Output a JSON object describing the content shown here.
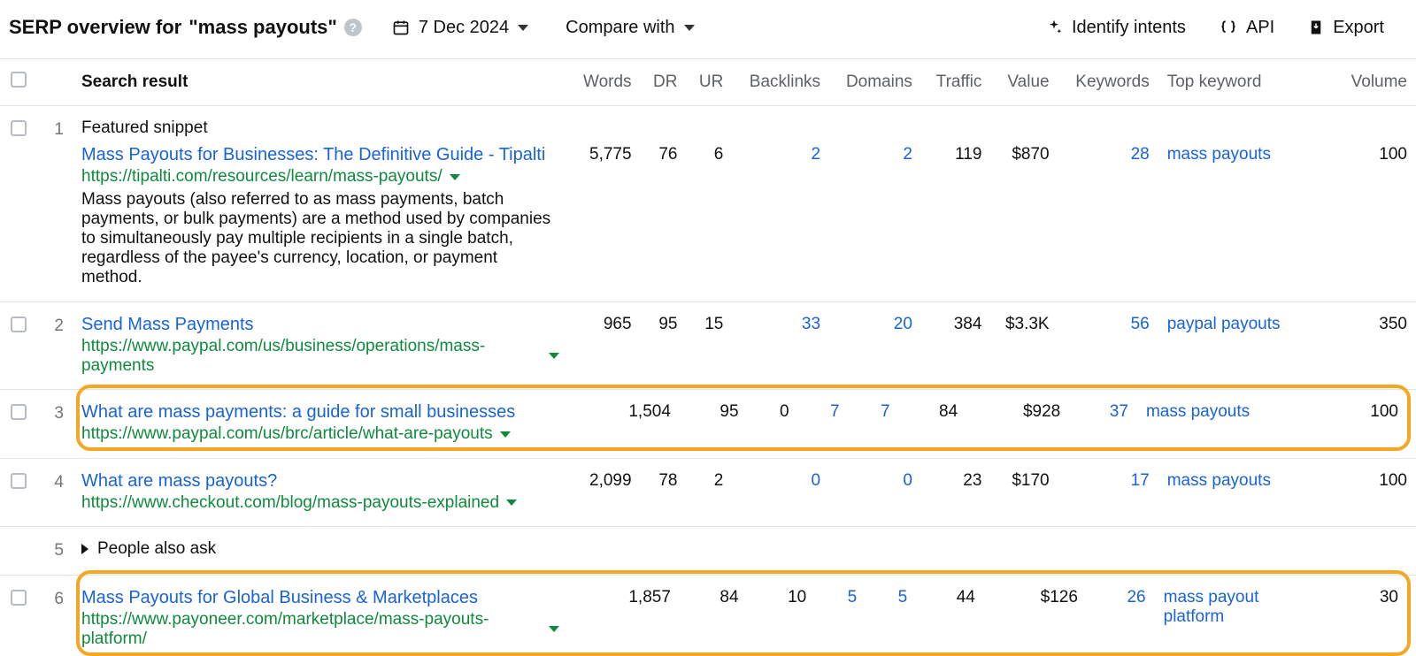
{
  "header": {
    "title_prefix": "SERP overview for",
    "query": "\"mass payouts\"",
    "date": "7 Dec 2024",
    "compare_label": "Compare with",
    "actions": {
      "identify_intents": "Identify intents",
      "api": "API",
      "export": "Export"
    }
  },
  "columns": {
    "search_result": "Search result",
    "words": "Words",
    "dr": "DR",
    "ur": "UR",
    "backlinks": "Backlinks",
    "domains": "Domains",
    "traffic": "Traffic",
    "value": "Value",
    "keywords": "Keywords",
    "top_keyword": "Top keyword",
    "volume": "Volume"
  },
  "rows": [
    {
      "pos": "1",
      "featured_label": "Featured snippet",
      "title": "Mass Payouts for Businesses: The Definitive Guide - Tipalti",
      "url": "https://tipalti.com/resources/learn/mass-payouts/",
      "snippet": "Mass payouts (also referred to as mass payments, batch payments, or bulk payments) are a method used by companies to simultaneously pay multiple recipients in a single batch, regardless of the payee's currency, location, or payment method.",
      "words": "5,775",
      "dr": "76",
      "ur": "6",
      "backlinks": "2",
      "domains": "2",
      "traffic": "119",
      "value": "$870",
      "keywords": "28",
      "top_keyword": "mass payouts",
      "volume": "100",
      "highlight": false
    },
    {
      "pos": "2",
      "title": "Send Mass Payments",
      "url": "https://www.paypal.com/us/business/operations/mass-payments",
      "words": "965",
      "dr": "95",
      "ur": "15",
      "backlinks": "33",
      "domains": "20",
      "traffic": "384",
      "value": "$3.3K",
      "keywords": "56",
      "top_keyword": "paypal payouts",
      "volume": "350",
      "highlight": false
    },
    {
      "pos": "3",
      "title": "What are mass payments: a guide for small businesses",
      "url": "https://www.paypal.com/us/brc/article/what-are-payouts",
      "words": "1,504",
      "dr": "95",
      "ur": "0",
      "backlinks": "7",
      "domains": "7",
      "traffic": "84",
      "value": "$928",
      "keywords": "37",
      "top_keyword": "mass payouts",
      "volume": "100",
      "highlight": true
    },
    {
      "pos": "4",
      "title": "What are mass payouts?",
      "url": "https://www.checkout.com/blog/mass-payouts-explained",
      "words": "2,099",
      "dr": "78",
      "ur": "2",
      "backlinks": "0",
      "domains": "0",
      "traffic": "23",
      "value": "$170",
      "keywords": "17",
      "top_keyword": "mass payouts",
      "volume": "100",
      "highlight": false
    },
    {
      "pos": "5",
      "paa_label": "People also ask"
    },
    {
      "pos": "6",
      "title": "Mass Payouts for Global Business & Marketplaces",
      "url": "https://www.payoneer.com/marketplace/mass-payouts-platform/",
      "words": "1,857",
      "dr": "84",
      "ur": "10",
      "backlinks": "5",
      "domains": "5",
      "traffic": "44",
      "value": "$126",
      "keywords": "26",
      "top_keyword": "mass payout platform",
      "volume": "30",
      "highlight": true
    }
  ]
}
